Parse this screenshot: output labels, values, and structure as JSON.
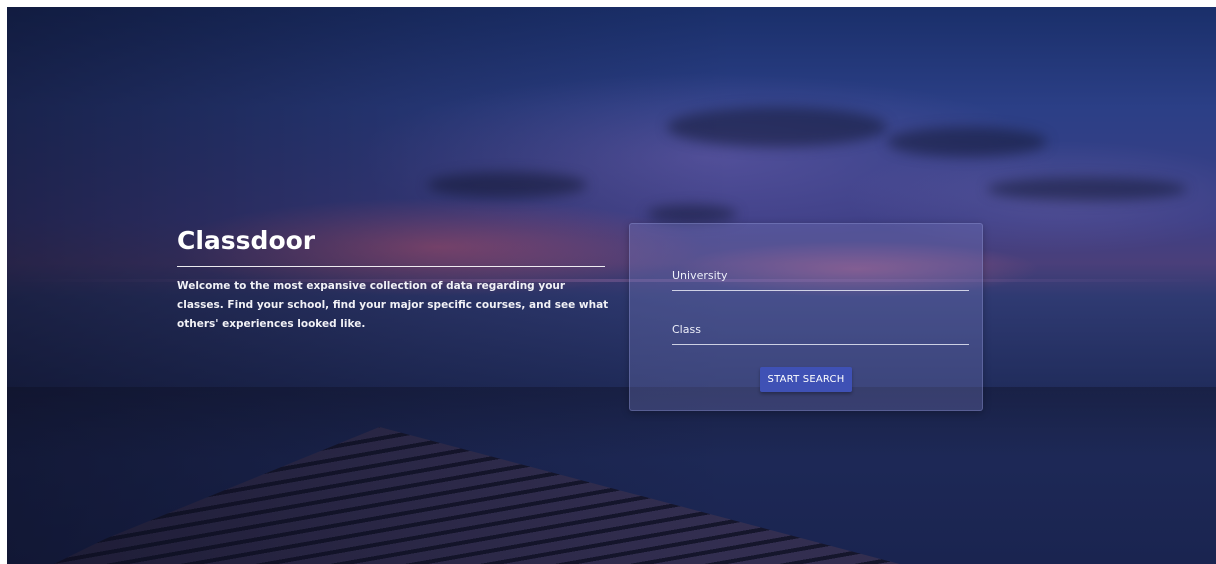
{
  "hero": {
    "title": "Classdoor",
    "description": "Welcome to the most expansive collection of data regarding your classes. Find your school, find your major specific courses, and see what others' experiences looked like."
  },
  "search": {
    "university_placeholder": "University",
    "class_placeholder": "Class",
    "submit_label": "START SEARCH"
  },
  "colors": {
    "button": "#3f51b5",
    "text": "#ffffff"
  }
}
